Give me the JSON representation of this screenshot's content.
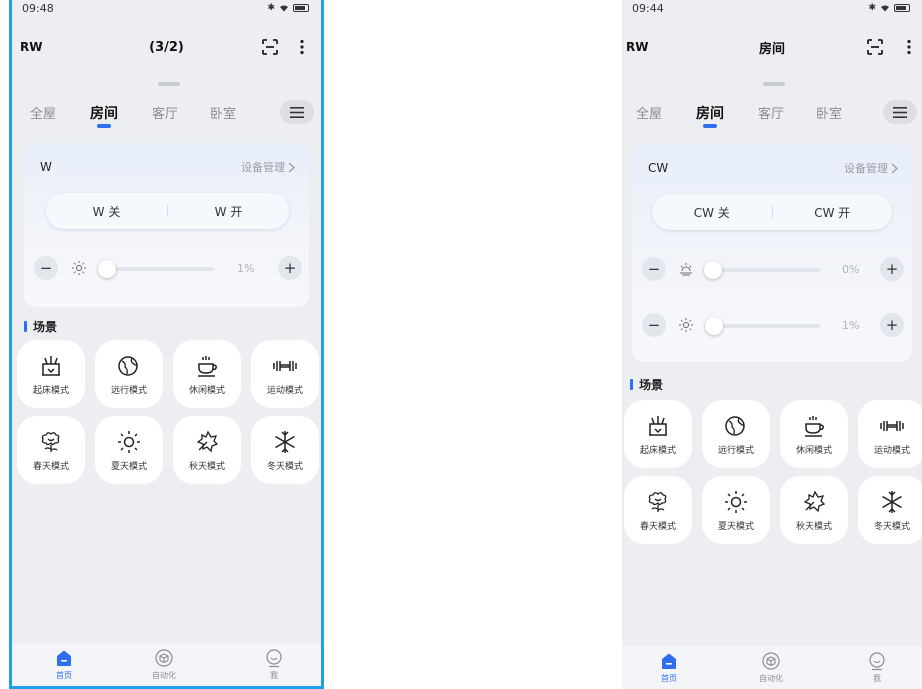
{
  "left": {
    "status": {
      "time": "09:48"
    },
    "app_name": "RW",
    "page_title": "(3/2)",
    "tabs": [
      {
        "label": "全屋"
      },
      {
        "label": "房间"
      },
      {
        "label": "客厅"
      },
      {
        "label": "卧室"
      }
    ],
    "device": {
      "name": "W",
      "manage_label": "设备管理",
      "off_label": "W 关",
      "on_label": "W 开",
      "sliders": [
        {
          "icon": "brightness-icon",
          "value": "1%",
          "level": 0.01
        }
      ]
    },
    "scenes_title": "场景",
    "scenes": [
      {
        "label": "起床模式",
        "icon": "wake-up-icon"
      },
      {
        "label": "远行模式",
        "icon": "globe-icon"
      },
      {
        "label": "休闲模式",
        "icon": "coffee-cup-icon"
      },
      {
        "label": "运动模式",
        "icon": "dumbbell-icon"
      },
      {
        "label": "春天模式",
        "icon": "flower-icon"
      },
      {
        "label": "夏天模式",
        "icon": "sun-icon"
      },
      {
        "label": "秋天模式",
        "icon": "leaf-icon"
      },
      {
        "label": "冬天模式",
        "icon": "snowflake-icon"
      }
    ],
    "nav": [
      {
        "label": "首页"
      },
      {
        "label": "自动化"
      },
      {
        "label": "我"
      }
    ]
  },
  "right": {
    "status": {
      "time": "09:44"
    },
    "app_name": "RW",
    "page_title": "房间",
    "tabs": [
      {
        "label": "全屋"
      },
      {
        "label": "房间"
      },
      {
        "label": "客厅"
      },
      {
        "label": "卧室"
      }
    ],
    "device": {
      "name": "CW",
      "manage_label": "设备管理",
      "off_label": "CW 关",
      "on_label": "CW 开",
      "sliders": [
        {
          "icon": "color-temperature-icon",
          "value": "0%",
          "level": 0
        },
        {
          "icon": "brightness-icon",
          "value": "1%",
          "level": 0.01
        }
      ]
    },
    "scenes_title": "场景",
    "scenes": [
      {
        "label": "起床模式",
        "icon": "wake-up-icon"
      },
      {
        "label": "远行模式",
        "icon": "globe-icon"
      },
      {
        "label": "休闲模式",
        "icon": "coffee-cup-icon"
      },
      {
        "label": "运动模式",
        "icon": "dumbbell-icon"
      },
      {
        "label": "春天模式",
        "icon": "flower-icon"
      },
      {
        "label": "夏天模式",
        "icon": "sun-icon"
      },
      {
        "label": "秋天模式",
        "icon": "leaf-icon"
      },
      {
        "label": "冬天模式",
        "icon": "snowflake-icon"
      }
    ],
    "nav": [
      {
        "label": "首页"
      },
      {
        "label": "自动化"
      },
      {
        "label": "我"
      }
    ]
  },
  "colors": {
    "accent": "#2d6ff0",
    "frame_border": "#1aa3ec",
    "background": "#edeef2"
  }
}
